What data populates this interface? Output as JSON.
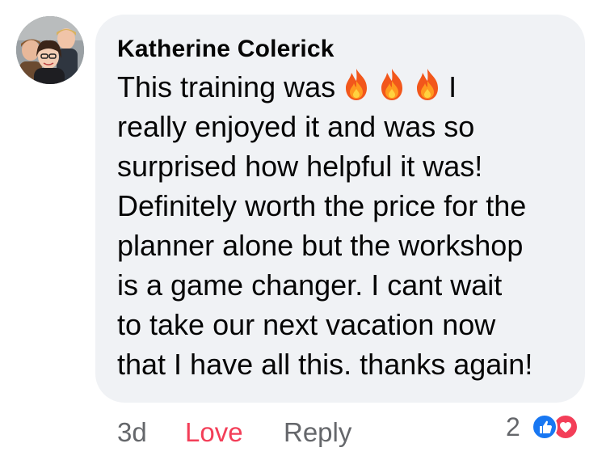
{
  "comment": {
    "author": "Katherine Colerick",
    "text_lines": [
      "This training was",
      "I",
      "really enjoyed it and was so",
      "surprised how helpful it was!",
      "Definitely worth the price for the",
      "planner alone but the workshop",
      "is a game changer. I cant wait",
      "to take our next vacation now",
      "that I have all this. thanks again!"
    ],
    "emoji": [
      "fire-icon",
      "fire-icon",
      "fire-icon"
    ]
  },
  "actions": {
    "time": "3d",
    "love_label": "Love",
    "reply_label": "Reply"
  },
  "reactions": {
    "count": "2",
    "icons": [
      "like-icon",
      "heart-icon"
    ]
  },
  "colors": {
    "bubble": "#f0f2f5",
    "author_text": "#050505",
    "secondary_text": "#65676b",
    "love": "#f33e58",
    "like": "#1877f2"
  }
}
